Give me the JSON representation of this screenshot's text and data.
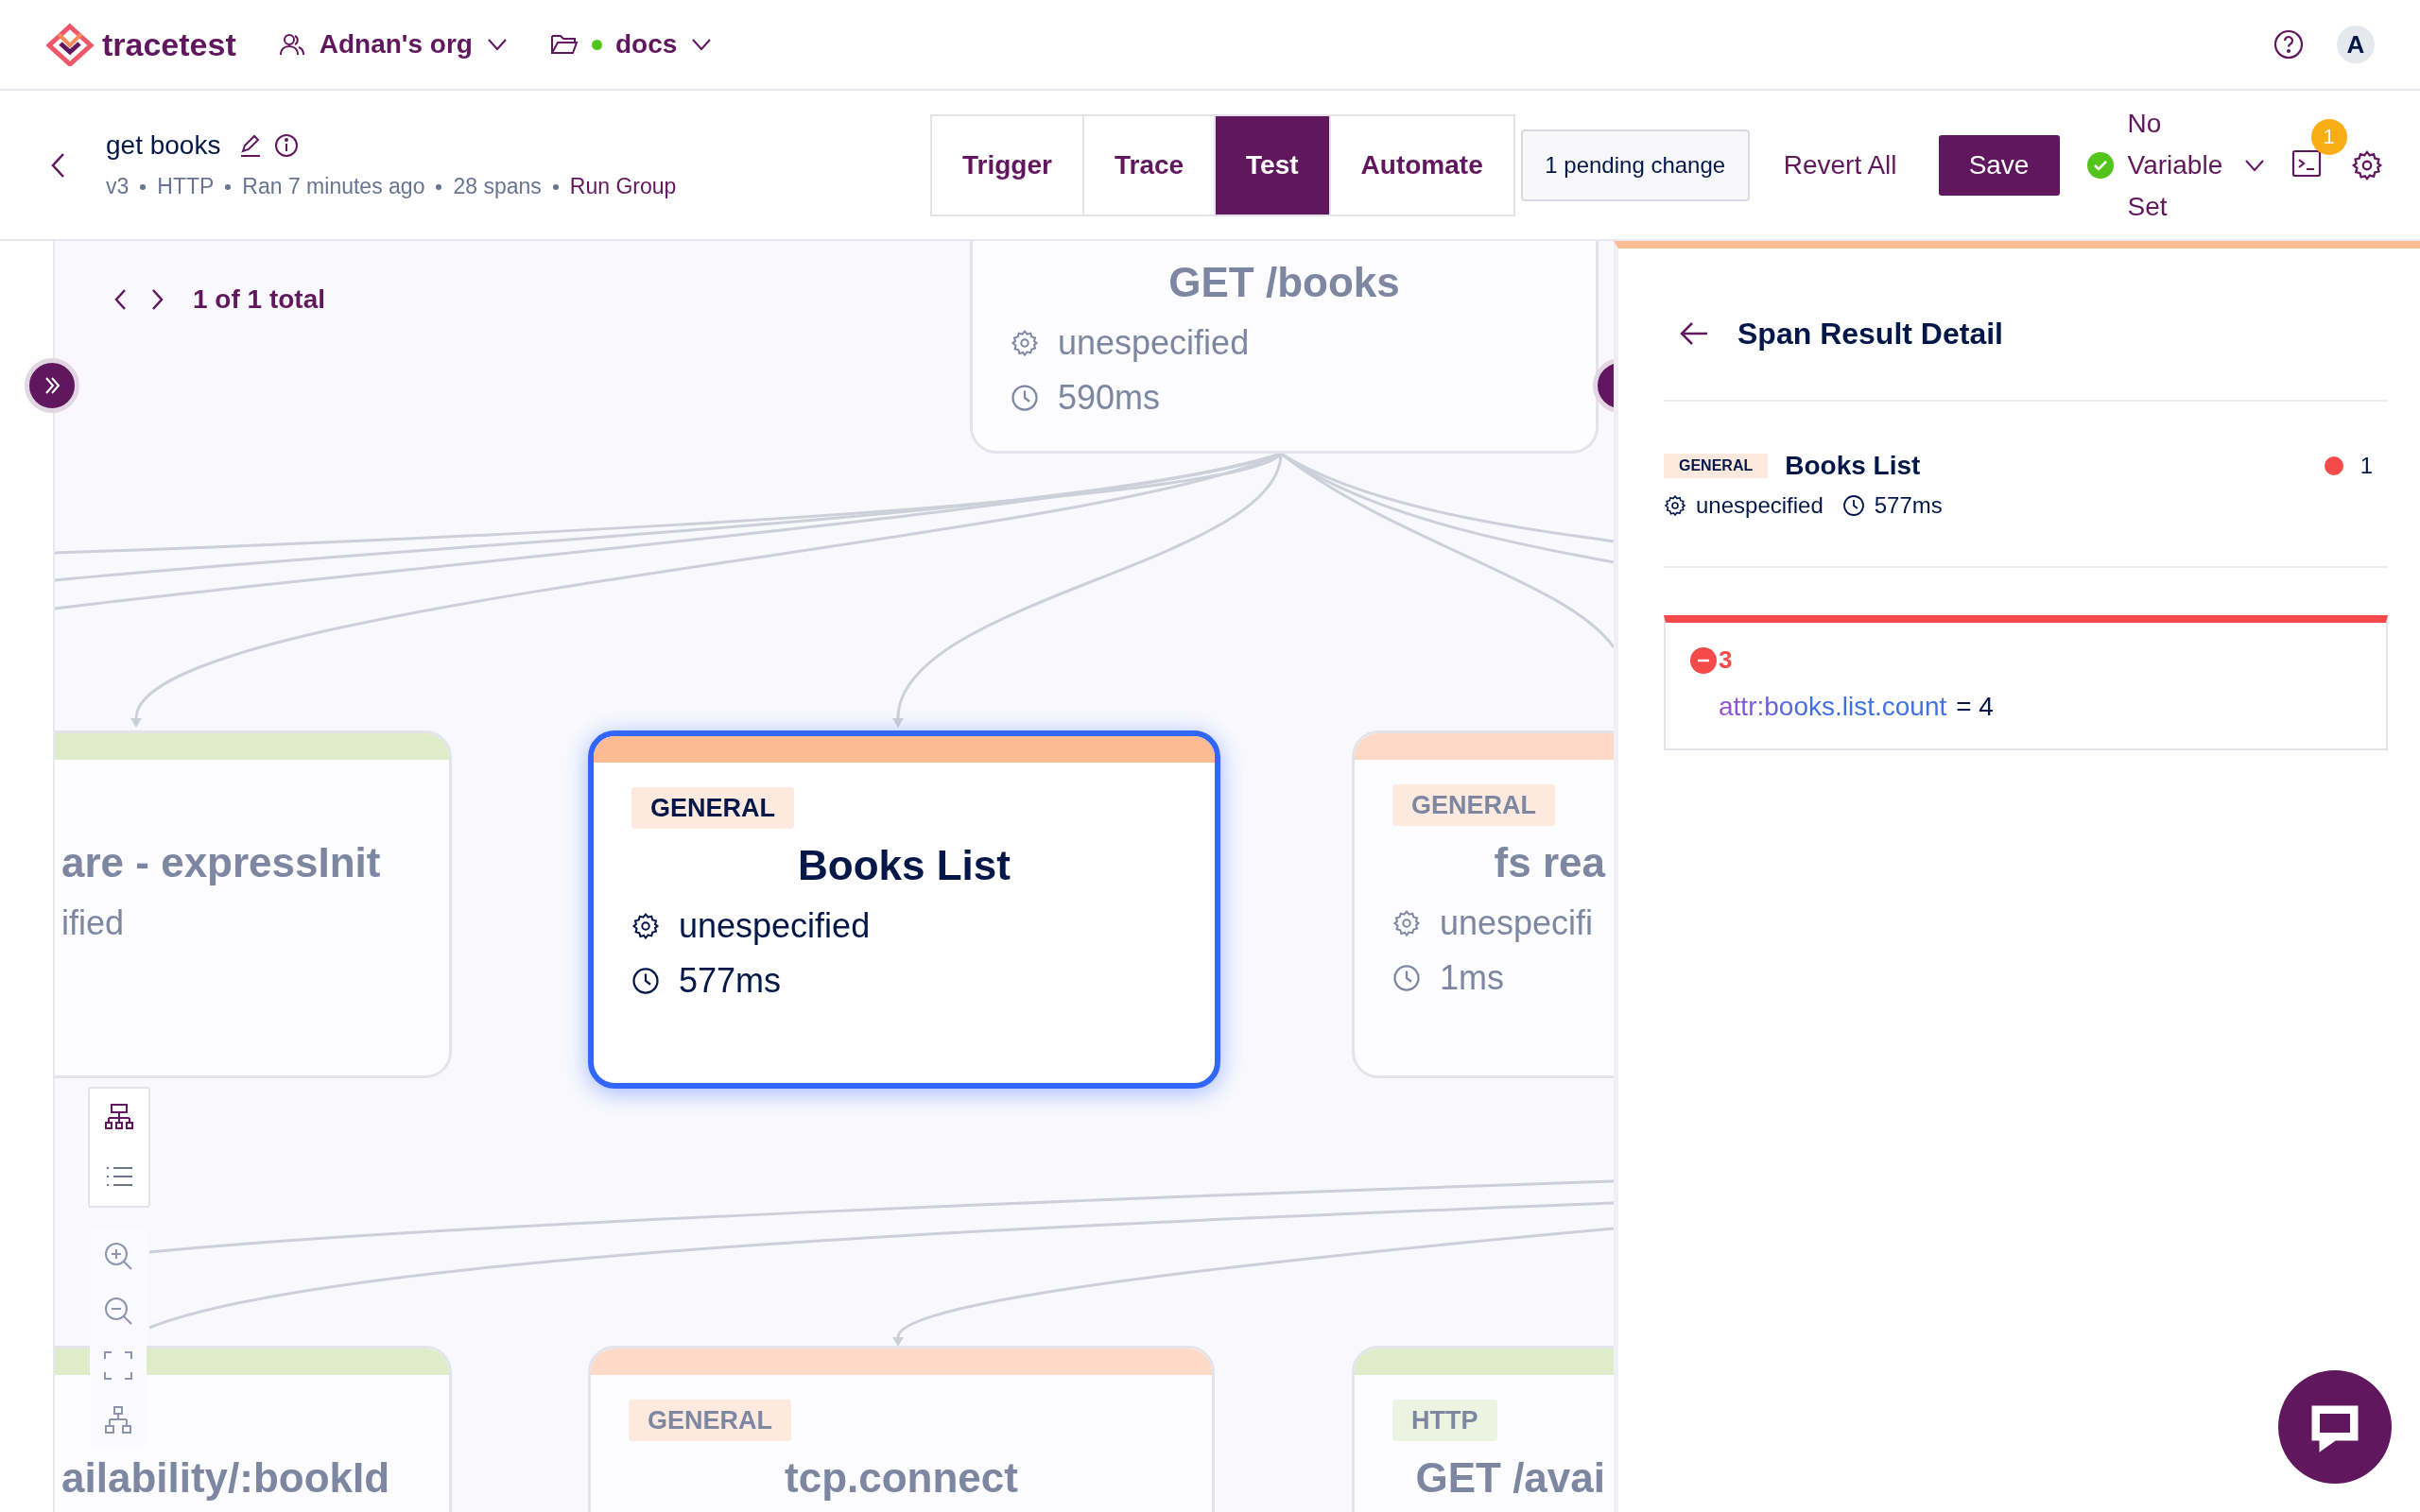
{
  "header": {
    "brand": "tracetest",
    "org": "Adnan's org",
    "environment": {
      "name": "docs",
      "connected": true
    },
    "avatar": "A"
  },
  "run": {
    "title": "get books",
    "meta": [
      "v3",
      "HTTP",
      "Ran 7 minutes ago",
      "28 spans"
    ],
    "run_group": "Run Group"
  },
  "tabs": [
    {
      "label": "Trigger",
      "selected": false
    },
    {
      "label": "Trace",
      "selected": false
    },
    {
      "label": "Test",
      "selected": true
    },
    {
      "label": "Automate",
      "selected": false
    }
  ],
  "pending": "1 pending change",
  "actions": {
    "revert": "Revert All",
    "save": "Save"
  },
  "variable_set": {
    "label": "No Variable Set",
    "valid": true
  },
  "output_badge": "1",
  "canvas": {
    "pager": "1 of 1 total",
    "nodes": [
      {
        "name": "GET /books",
        "service": "unespecified",
        "duration": "590ms",
        "selected": false
      },
      {
        "name": "are - expressInit",
        "service": "ified",
        "selected": false,
        "color": "#dfecc9"
      },
      {
        "type": "GENERAL",
        "name": "Books List",
        "service": "unespecified",
        "duration": "577ms",
        "selected": true,
        "color": "#fdbb94"
      },
      {
        "type": "GENERAL",
        "name": "fs rea",
        "service": "unespecifi",
        "duration": "1ms",
        "selected": false,
        "color": "#fdd9c8"
      },
      {
        "name": "ailability/:bookId",
        "selected": false,
        "color": "#dfecc9"
      },
      {
        "type": "GENERAL",
        "name": "tcp.connect",
        "selected": false,
        "color": "#fdd9c8"
      },
      {
        "type": "HTTP",
        "name": "GET /avai",
        "selected": false,
        "color": "#dfecc9"
      }
    ]
  },
  "detail": {
    "title": "Span Result Detail",
    "span": {
      "type": "GENERAL",
      "name": "Books List",
      "service": "unespecified",
      "duration": "577ms",
      "failed": "1"
    },
    "assertion": {
      "failed": "3",
      "attribute": "attr:books.list.count",
      "comparison": "= 4"
    }
  }
}
